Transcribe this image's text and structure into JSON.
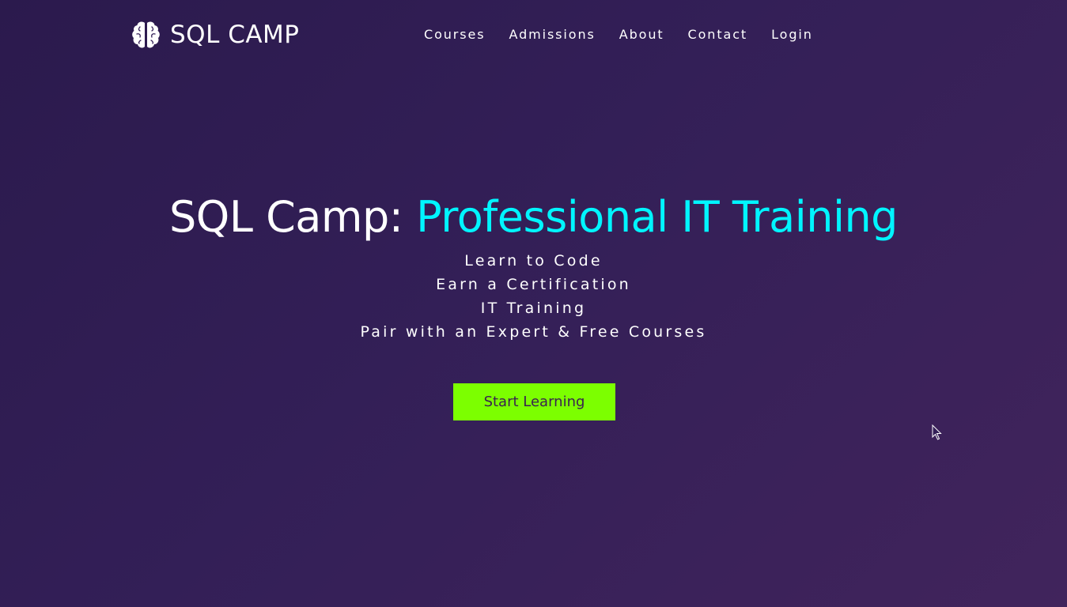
{
  "nav": {
    "brand": "SQL CAMP",
    "brand_icon": "brain-icon",
    "links": [
      "Courses",
      "Admissions",
      "About",
      "Contact",
      "Login"
    ]
  },
  "hero": {
    "title_prefix": "SQL Camp: ",
    "title_accent": "Professional IT Training",
    "taglines": [
      "Learn to Code",
      "Earn a Certification",
      "IT Training",
      "Pair with an Expert & Free Courses"
    ],
    "cta_label": "Start Learning"
  },
  "colors": {
    "background": "#331f57",
    "accent": "#00f5ff",
    "cta_background": "#7cff00",
    "cta_text": "#3a2250",
    "text": "#ffffff"
  }
}
